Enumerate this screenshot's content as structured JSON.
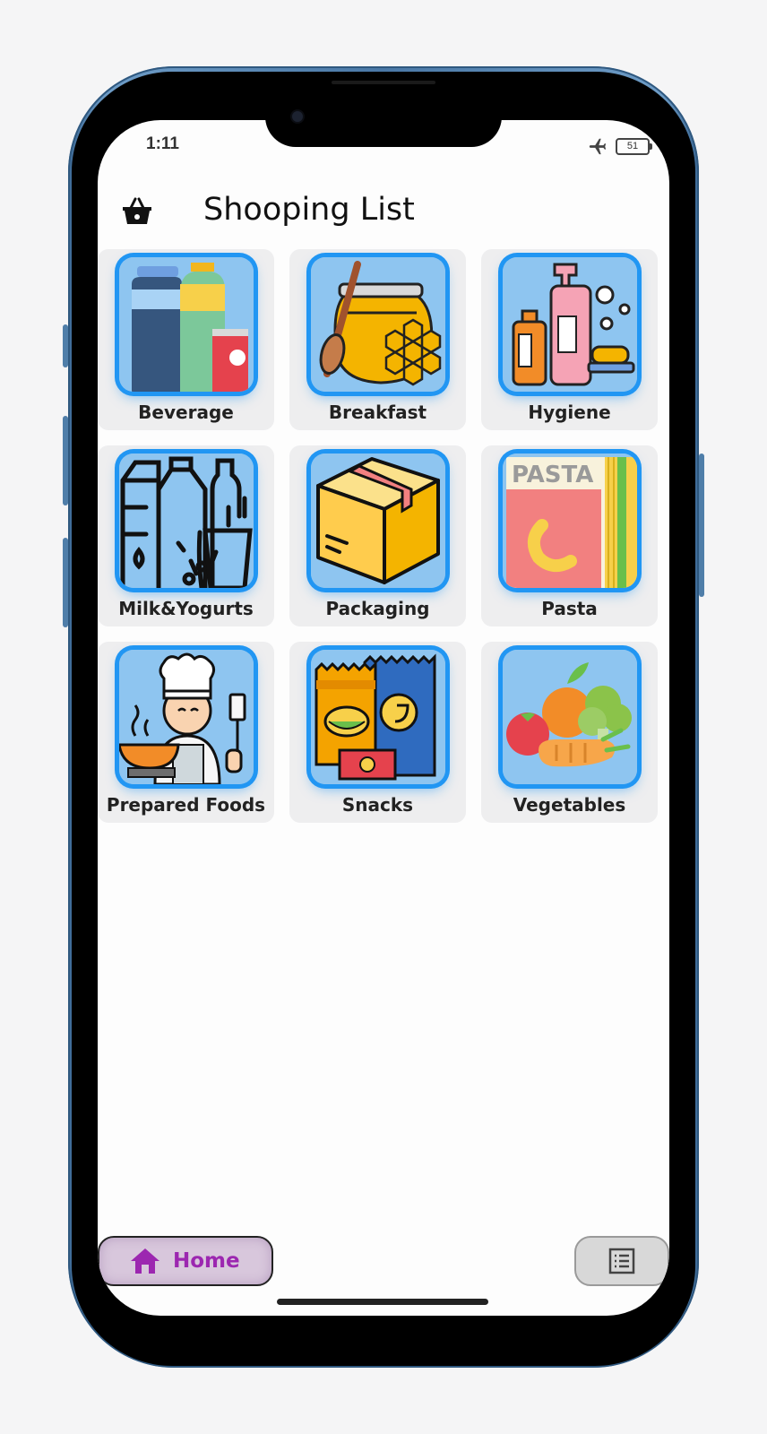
{
  "status": {
    "time": "1:11",
    "battery": "51",
    "airplane_icon": "airplane-icon"
  },
  "app_bar": {
    "title": "Shooping List",
    "icon": "basket-icon"
  },
  "categories": [
    {
      "label": "Beverage",
      "icon": "beverage-icon"
    },
    {
      "label": "Breakfast",
      "icon": "honey-jar-icon"
    },
    {
      "label": "Hygiene",
      "icon": "hygiene-bottles-icon"
    },
    {
      "label": "Milk&Yogurts",
      "icon": "milk-bottles-icon"
    },
    {
      "label": "Packaging",
      "icon": "box-icon"
    },
    {
      "label": "Pasta",
      "icon": "pasta-box-icon"
    },
    {
      "label": "Prepared Foods",
      "icon": "chef-icon"
    },
    {
      "label": "Snacks",
      "icon": "snack-bags-icon"
    },
    {
      "label": "Vegetables",
      "icon": "vegetables-icon"
    }
  ],
  "bottom_nav": {
    "home_label": "Home",
    "home_icon": "home-icon",
    "list_icon": "list-icon"
  },
  "colors": {
    "accent": "#9c27b0",
    "tile_border": "#2196f3",
    "tile_bg": "#8ec5f0"
  }
}
